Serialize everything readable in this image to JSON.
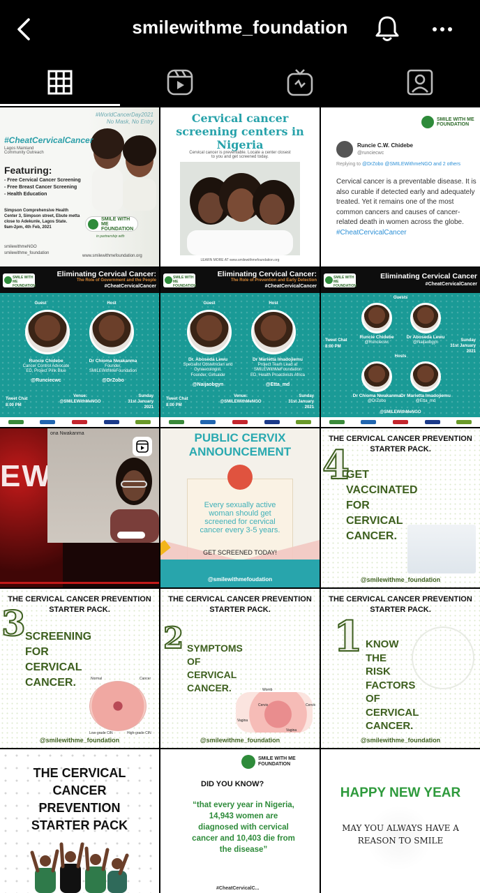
{
  "header": {
    "title": "smilewithme_foundation",
    "back_icon": "chevron-left-icon",
    "bell_icon": "bell-icon",
    "more_icon": "more-horizontal-icon"
  },
  "tabs": [
    {
      "icon": "grid-icon",
      "active": true
    },
    {
      "icon": "reels-icon",
      "active": false
    },
    {
      "icon": "igtv-icon",
      "active": false
    },
    {
      "icon": "tagged-icon",
      "active": false
    }
  ],
  "posts": {
    "p1": {
      "tag": "#WorldCancerDay2021\nNo Mask, No Entry",
      "hashtag": "#CheatCervicalCancer",
      "sub": "Lagos Mainland Community Outreach",
      "featuring": "Featuring:",
      "items": "- Free Cervical Cancer Screening\n- Free Breast Cancer Screening\n- Health Education",
      "location": "Simpson Comprehensive Health Center 3, Simpson street, Ebute metta close to Adekunle, Lagos State.\n9am-2pm, 4th Feb, 2021",
      "logo": "SMILE WITH ME FOUNDATION",
      "partner": "in partnership with",
      "socials": "smilewithmeNGO\nsmilewithme_foundation",
      "site": "www.smilewithmefoundation.org"
    },
    "p2": {
      "title": "Cervical cancer screening centers in Nigeria",
      "sub": "Cervical cancer is preventable. Locate a center closest to you and get screened today.",
      "footer": "LEARN MORE AT www.smilewithmefoundation.org"
    },
    "p3": {
      "logo": "SMILE WITH ME FOUNDATION",
      "name": "Runcie C.W. Chidebe",
      "handle": "@runciecwc",
      "reply_prefix": "Replying to",
      "reply_to": "@DrZobo @SMILEWithmeNGO and 2 others",
      "body": "Cervical cancer is a preventable disease. It is also curable if detected early and adequately treated. Yet it remains one of the most common cancers and causes of cancer-related death in women across the globe.",
      "hashtag": "#CheatCervicalCancer"
    },
    "p4": {
      "logo": "SMILE WITH ME FOUNDATION",
      "title": "Eliminating Cervical Cancer:",
      "subtitle": "The Role of Government and the People",
      "hashtag": "#CheatCervicalCancer",
      "guest_label": "Guest",
      "host_label": "Host",
      "guest_name": "Runcie Chidebe",
      "guest_desc": "Cancer Control Advocate\nED, Project Pink Blue",
      "guest_handle": "@Runciecwc",
      "host_name": "Dr Chioma Nwakanma",
      "host_desc": "Founder,\nSMILEWithMeFoundation",
      "host_handle": "@DrZobo",
      "tweet_chat": "Tweet Chat",
      "time": "8:00 PM",
      "venue_label": "Venue:",
      "venue": "@SMILEWithMeNGO",
      "date": "Sunday\n31st January\n2021"
    },
    "p5": {
      "logo": "SMILE WITH ME FOUNDATION",
      "title": "Eliminating Cervical Cancer:",
      "subtitle": "The Role of Prevention and Early Detection",
      "hashtag": "#CheatCervicalCancer",
      "guest_label": "Guest",
      "host_label": "Host",
      "guest_name": "Dr. Aboseda Lewu",
      "guest_desc": "Specialist Obstetrician and\nGynaecologist.\nFounder, Girlsaide",
      "guest_handle": "@Naijaobgyn",
      "host_name": "Dr Marietta Imadojiemu",
      "host_desc": "Project Team Lead at\nSMILEWithMeFoundation\nED, Health Proactivists Africa",
      "host_handle": "@Etta_md",
      "tweet_chat": "Tweet Chat",
      "time": "8:00 PM",
      "venue_label": "Venue:",
      "venue": "@SMILEWithMeNGO",
      "date": "Sunday\n31st January\n2021"
    },
    "p6": {
      "logo": "SMILE WITH ME FOUNDATION",
      "title": "Eliminating Cervical Cancer",
      "hashtag": "#CheatCervicalCancer",
      "guests_label": "Guests",
      "hosts_label": "Hosts",
      "g1_name": "Runcie Chidebe",
      "g1_handle": "@Runciecwc",
      "g2_name": "Dr Aboseda Lewu",
      "g2_handle": "@Naijaobgyn",
      "h1_name": "Dr Chioma Nwakanma",
      "h1_handle": "@DrZobo",
      "h2_name": "Dr Marietta Imadojiemu",
      "h2_handle": "@Etta_md",
      "tweet_chat": "Tweet Chat",
      "time": "8:00 PM",
      "venue": "@SMILEWithMeNGO",
      "date": "Sunday\n31st January\n2021"
    },
    "p7": {
      "ews": "EWS",
      "window_name": "ona Nwakanma",
      "reel_icon": "reels-icon"
    },
    "p8": {
      "title": "PUBLIC CERVIX ANNOUNCEMENT",
      "message": "Every sexually active woman should get screened for cervical cancer every 3-5 years.",
      "cta": "GET SCREENED TODAY!",
      "handle": "@smilewithmefoudation"
    },
    "p9": {
      "header": "THE CERVICAL CANCER PREVENTION STARTER PACK.",
      "number": "4",
      "text": "GET\nVACCINATED\nFOR\nCERVICAL\nCANCER.",
      "handle": "@smilewithme_foundation"
    },
    "p10": {
      "header": "THE CERVICAL CANCER PREVENTION STARTER PACK.",
      "number": "3",
      "text": "SCREENING\nFOR\nCERVICAL\nCANCER.",
      "labels": [
        "Normal",
        "Cancer",
        "Low-grade CIN",
        "High-grade CIN"
      ],
      "handle": "@smilewithme_foundation"
    },
    "p11": {
      "header": "THE CERVICAL CANCER PREVENTION STARTER PACK.",
      "number": "2",
      "text": "SYMPTOMS\nOF\nCERVICAL\nCANCER.",
      "labels": [
        "Womb",
        "Cervix",
        "Vagina",
        "Cervix",
        "Vagina"
      ],
      "handle": "@smilewithme_foundation"
    },
    "p12": {
      "header": "THE CERVICAL CANCER PREVENTION STARTER PACK.",
      "number": "1",
      "text": "KNOW\nTHE\nRISK\nFACTORS\nOF\nCERVICAL\nCANCER.",
      "handle": "@smilewithme_foundation"
    },
    "p13": {
      "title": "THE CERVICAL CANCER PREVENTION STARTER PACK"
    },
    "p14": {
      "logo": "SMILE WITH ME FOUNDATION",
      "title": "DID YOU KNOW?",
      "quote": "“that every year in Nigeria, 14,943 women are diagnosed with cervical cancer and 10,403 die from the disease”",
      "cut": "#CheatCervicalC..."
    },
    "p15": {
      "title": "HAPPY NEW YEAR",
      "wish": "MAY YOU ALWAYS HAVE A REASON TO SMILE"
    }
  },
  "colors": {
    "background": "#000000",
    "teal": "#1a9a96",
    "green": "#3d5f1e",
    "link_blue": "#2b8fd6"
  }
}
